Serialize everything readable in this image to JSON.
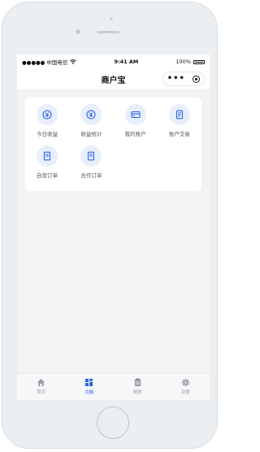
{
  "status_bar": {
    "carrier": "●●●●● 中国电信",
    "time": "9:41 AM",
    "battery": "100%"
  },
  "nav": {
    "title": "商户宝",
    "more_icon": "ellipsis-icon",
    "close_icon": "target-icon"
  },
  "grid_items": [
    {
      "label": "今日收益",
      "icon": "yen-coin-icon"
    },
    {
      "label": "收益统计",
      "icon": "yen-coin-icon"
    },
    {
      "label": "我的账户",
      "icon": "card-icon"
    },
    {
      "label": "账户交易",
      "icon": "receipt-icon"
    },
    {
      "label": "自营订单",
      "icon": "document-icon"
    },
    {
      "label": "合作订单",
      "icon": "document-icon"
    }
  ],
  "tabs": [
    {
      "label": "首页",
      "icon": "home-icon",
      "active": false
    },
    {
      "label": "功能",
      "icon": "grid-icon",
      "active": true
    },
    {
      "label": "报表",
      "icon": "clipboard-icon",
      "active": false
    },
    {
      "label": "设置",
      "icon": "gear-icon",
      "active": false
    }
  ],
  "colors": {
    "accent": "#2a64e6",
    "tile_bg": "#e8eefb",
    "tab_inactive": "#9a9ea6"
  }
}
